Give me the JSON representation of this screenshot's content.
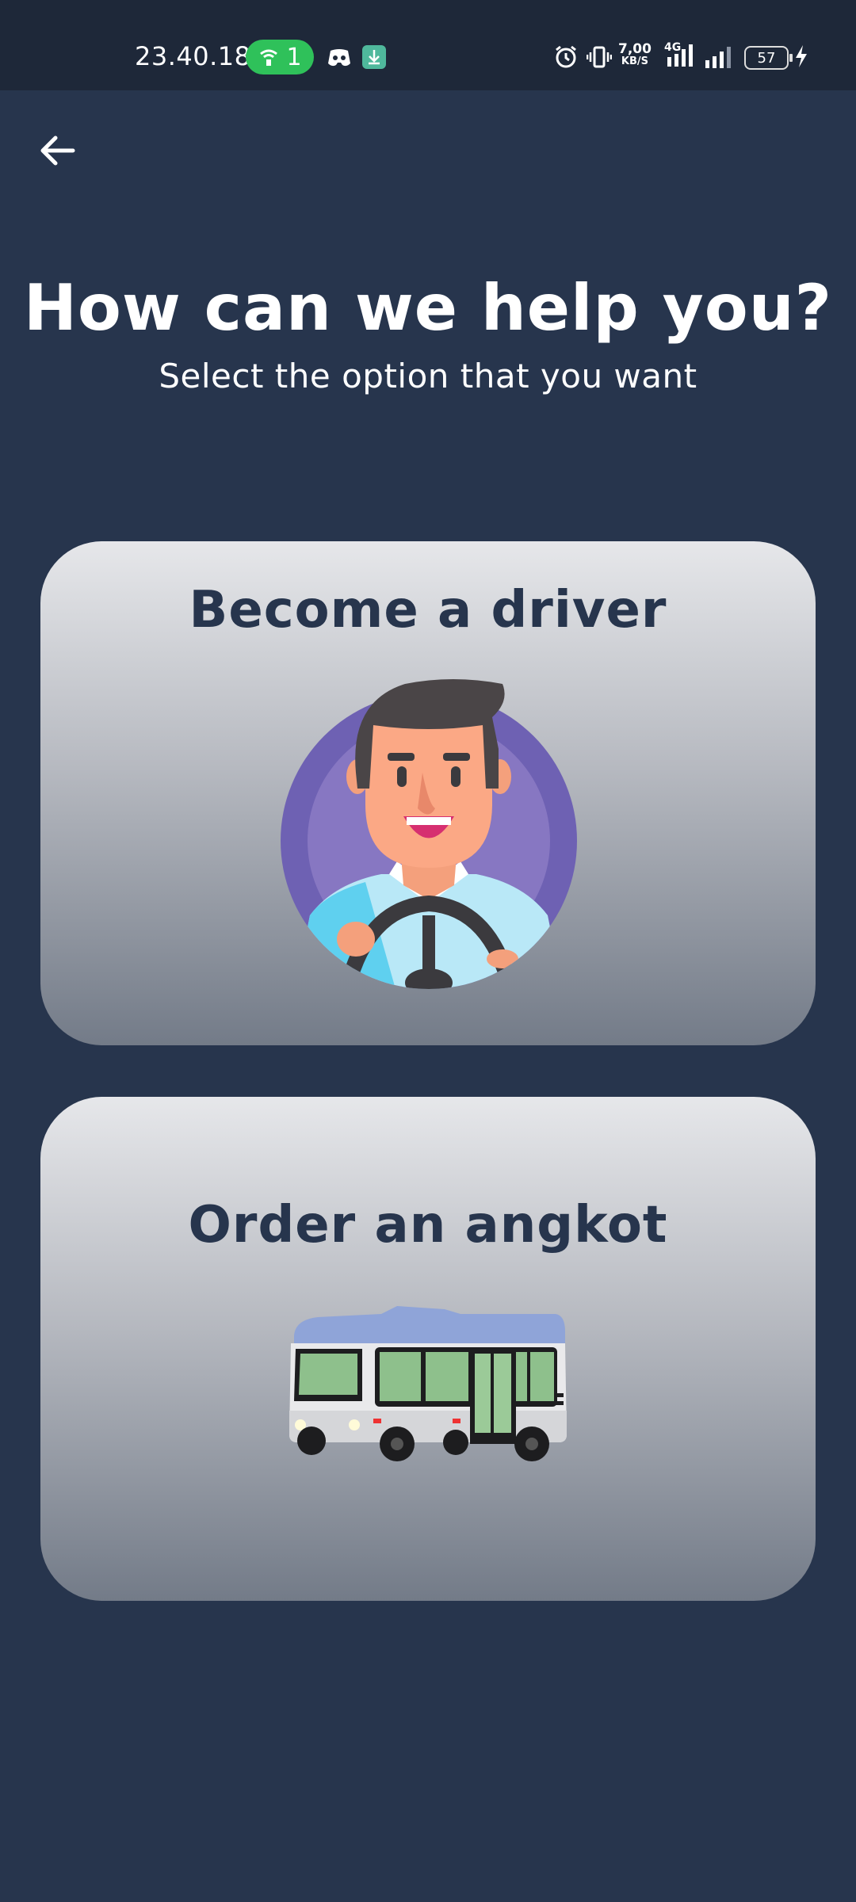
{
  "status_bar": {
    "time": "23.40.18",
    "hotspot_count": "1",
    "net_speed_value": "7,00",
    "net_speed_unit": "KB/S",
    "network_type": "4G",
    "battery": "57"
  },
  "header": {
    "title": "How can we help you?",
    "subtitle": "Select the option that you want"
  },
  "options": [
    {
      "label": "Become a driver",
      "icon": "driver-illustration"
    },
    {
      "label": "Order an angkot",
      "icon": "bus-illustration"
    }
  ],
  "colors": {
    "background": "#27354d",
    "status_bar": "#1e2839",
    "card_text": "#27354d",
    "hotspot": "#2fc15a"
  }
}
